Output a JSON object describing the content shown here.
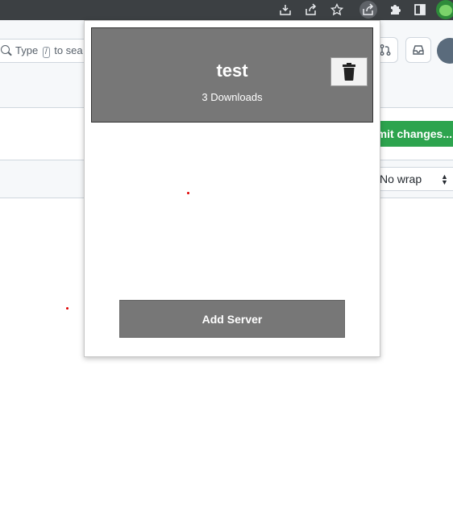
{
  "popup": {
    "servers": [
      {
        "name": "test",
        "downloads": "3 Downloads"
      }
    ],
    "add_button_label": "Add Server"
  },
  "page": {
    "search_placeholder_prefix": "Type",
    "search_key": "/",
    "search_placeholder_suffix": "to sea",
    "commit_button_label": "mmit changes...",
    "wrap_select_value": "No wrap"
  },
  "toolbar_icons": [
    "download-icon",
    "share-icon",
    "star-icon",
    "share-active-icon",
    "extensions-puzzle-icon",
    "side-panel-icon",
    "profile-avatar"
  ],
  "colors": {
    "toolbar": "#3c4043",
    "card_bg": "#777777",
    "commit_green": "#2da44e",
    "dot_red": "#e00000"
  }
}
